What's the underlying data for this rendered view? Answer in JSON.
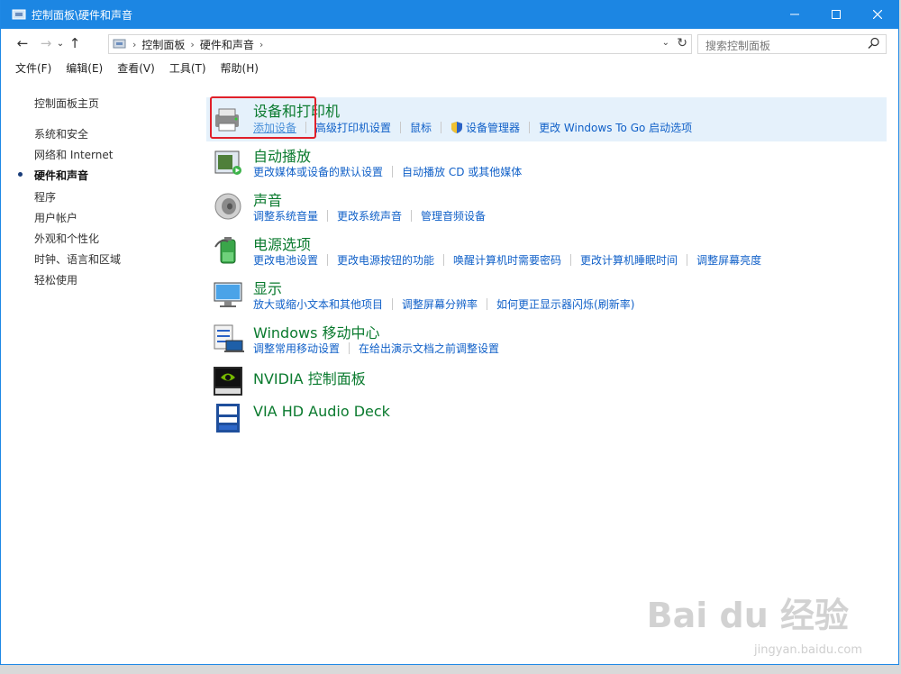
{
  "window": {
    "title": "控制面板\\硬件和声音"
  },
  "address": {
    "crumbs": [
      "控制面板",
      "硬件和声音"
    ]
  },
  "search": {
    "placeholder": "搜索控制面板"
  },
  "menu": [
    "文件(F)",
    "编辑(E)",
    "查看(V)",
    "工具(T)",
    "帮助(H)"
  ],
  "sidebar": {
    "home": "控制面板主页",
    "items": [
      "系统和安全",
      "网络和 Internet",
      "硬件和声音",
      "程序",
      "用户帐户",
      "外观和个性化",
      "时钟、语言和区域",
      "轻松使用"
    ],
    "active_index": 2
  },
  "categories": [
    {
      "icon": "printer-icon",
      "title": "设备和打印机",
      "links": [
        "添加设备",
        "高级打印机设置",
        "鼠标",
        "设备管理器",
        "更改 Windows To Go 启动选项"
      ]
    },
    {
      "icon": "autoplay-icon",
      "title": "自动播放",
      "links": [
        "更改媒体或设备的默认设置",
        "自动播放 CD 或其他媒体"
      ]
    },
    {
      "icon": "speaker-icon",
      "title": "声音",
      "links": [
        "调整系统音量",
        "更改系统声音",
        "管理音频设备"
      ]
    },
    {
      "icon": "battery-icon",
      "title": "电源选项",
      "links": [
        "更改电池设置",
        "更改电源按钮的功能",
        "唤醒计算机时需要密码",
        "更改计算机睡眠时间",
        "调整屏幕亮度"
      ]
    },
    {
      "icon": "monitor-icon",
      "title": "显示",
      "links": [
        "放大或缩小文本和其他项目",
        "调整屏幕分辨率",
        "如何更正显示器闪烁(刷新率)"
      ]
    },
    {
      "icon": "mobility-center-icon",
      "title": "Windows 移动中心",
      "links": [
        "调整常用移动设置",
        "在给出演示文档之前调整设置"
      ]
    },
    {
      "icon": "nvidia-icon",
      "title": "NVIDIA 控制面板",
      "links": []
    },
    {
      "icon": "via-audio-icon",
      "title": "VIA HD Audio Deck",
      "links": []
    }
  ],
  "watermark": {
    "brand": "Bai du 经验",
    "url": "jingyan.baidu.com"
  },
  "colors": {
    "titlebar": "#1c86e3",
    "link": "#1060c8",
    "category_title": "#0a7a2e",
    "highlight": "#e0202a",
    "selected_row": "#e5f1fb"
  }
}
